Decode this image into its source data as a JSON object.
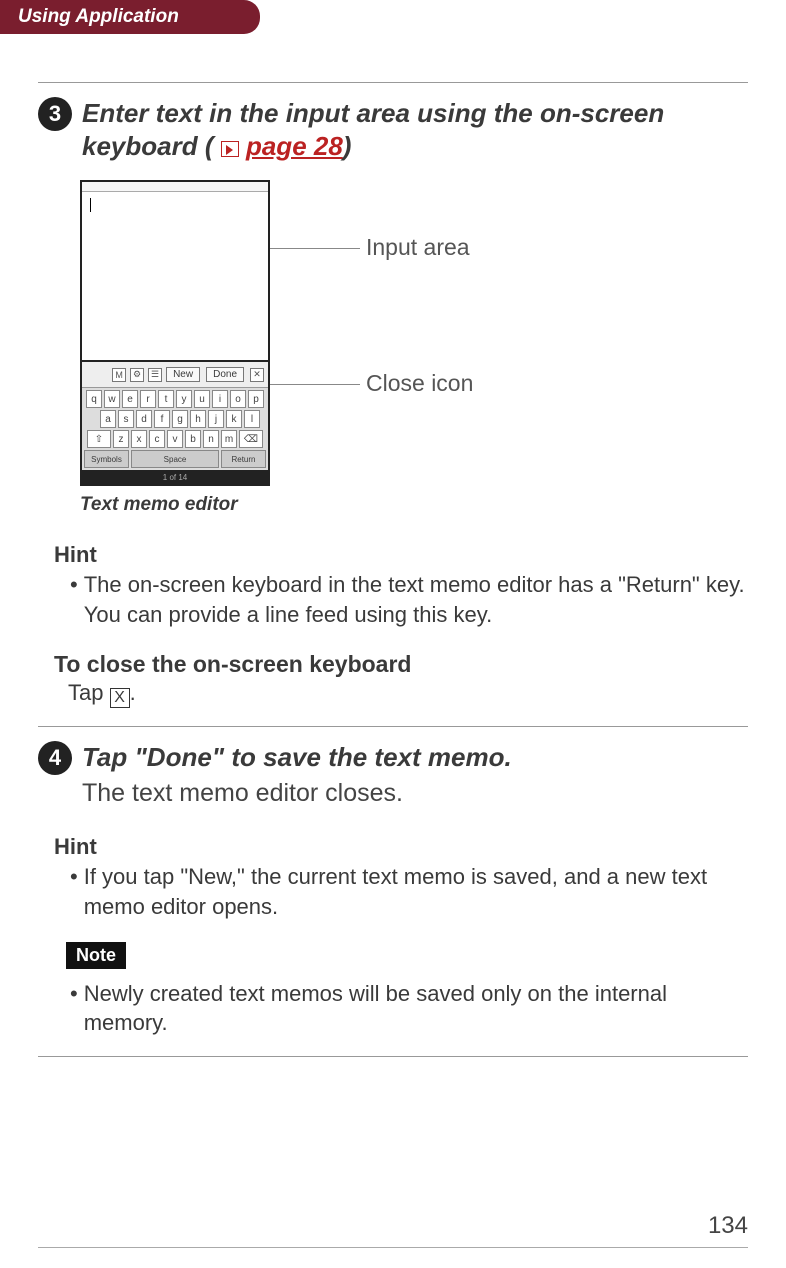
{
  "header": {
    "title": "Using Application"
  },
  "step3": {
    "number": "3",
    "title_a": "Enter text in the input area using the on-screen keyboard (",
    "title_link": "page 28",
    "title_b": ")"
  },
  "figure": {
    "label_input": "Input area",
    "label_close": "Close icon",
    "caption": "Text memo editor",
    "btn_new": "New",
    "btn_done": "Done",
    "footer_text": "1 of 14",
    "kb_sym": "Symbols",
    "kb_space": "Space",
    "kb_return": "Return",
    "row1": [
      "q",
      "w",
      "e",
      "r",
      "t",
      "y",
      "u",
      "i",
      "o",
      "p"
    ],
    "row2": [
      "a",
      "s",
      "d",
      "f",
      "g",
      "h",
      "j",
      "k",
      "l"
    ],
    "row3": [
      "⇧",
      "z",
      "x",
      "c",
      "v",
      "b",
      "n",
      "m",
      "⌫"
    ]
  },
  "hint1": {
    "heading": "Hint",
    "text": "The on-screen keyboard in the text memo editor has a \"Return\" key. You can provide a line feed using this key."
  },
  "closekb": {
    "heading": "To close the on-screen keyboard",
    "pre": "Tap ",
    "x": "X",
    "post": "."
  },
  "step4": {
    "number": "4",
    "title": "Tap \"Done\" to save the text memo.",
    "body": "The text memo editor closes."
  },
  "hint2": {
    "heading": "Hint",
    "text": "If you tap \"New,\" the current text memo is saved, and a new text memo editor opens."
  },
  "note": {
    "badge": "Note",
    "text": "Newly created text memos will be saved only on the internal memory."
  },
  "page_number": "134"
}
